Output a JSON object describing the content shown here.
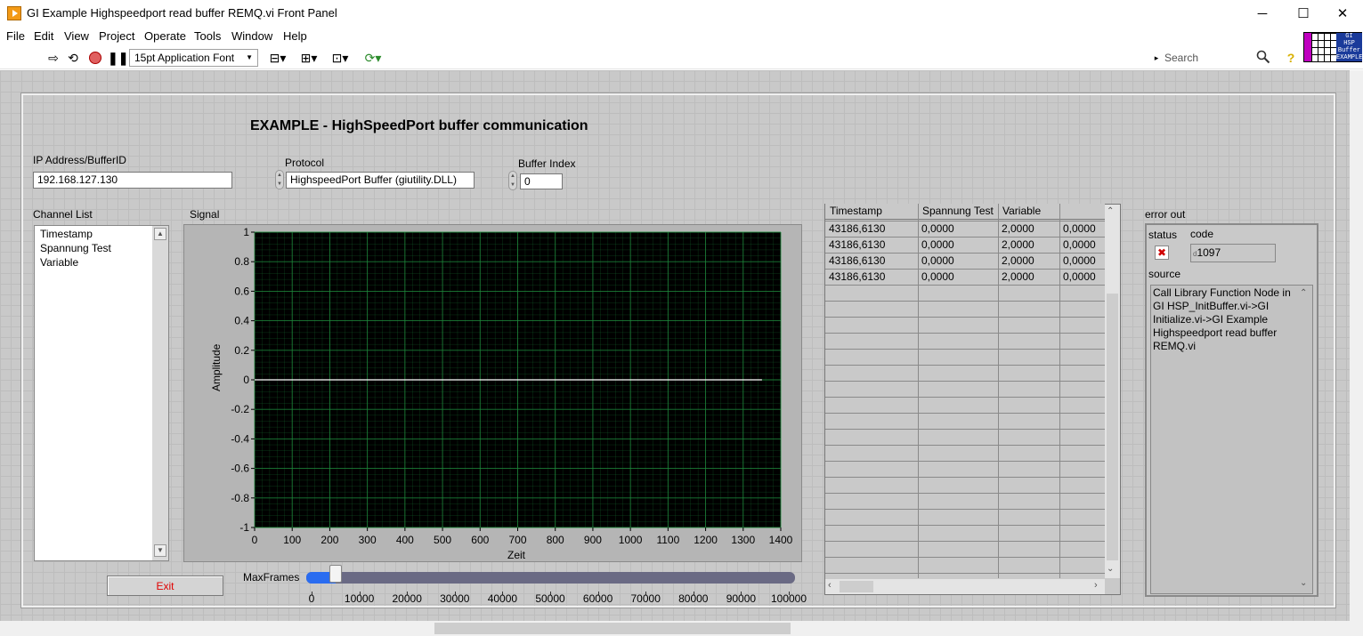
{
  "window": {
    "title": "GI Example Highspeedport read buffer REMQ.vi Front Panel",
    "minimize": "─",
    "maximize": "☐",
    "close": "✕"
  },
  "menu": [
    "File",
    "Edit",
    "View",
    "Project",
    "Operate",
    "Tools",
    "Window",
    "Help"
  ],
  "toolbar": {
    "font": "15pt Application Font",
    "search_placeholder": "Search",
    "icons": [
      "run-arrow-icon",
      "run-continuously-icon",
      "abort-icon",
      "pause-icon",
      "align-icon",
      "distribute-icon",
      "resize-icon",
      "reorder-icon",
      "search-icon",
      "help-icon"
    ]
  },
  "vi_icon": {
    "line1": "GI",
    "line2": "HSP",
    "line3": "Buffer",
    "line4": "EXAMPLE"
  },
  "panel": {
    "heading": "EXAMPLE - HighSpeedPort buffer communication",
    "ip_label": "IP Address/BufferID",
    "ip_value": "192.168.127.130",
    "protocol_label": "Protocol",
    "protocol_value": "HighspeedPort Buffer (giutility.DLL)",
    "buffer_index_label": "Buffer Index",
    "buffer_index_value": "0",
    "channel_list_label": "Channel List",
    "channel_list": [
      "Timestamp",
      "Spannung Test",
      "Variable"
    ],
    "exit_label": "Exit",
    "maxframes_label": "MaxFrames",
    "maxframes_value": 5000,
    "maxframes_ticks": [
      "0",
      "10000",
      "20000",
      "30000",
      "40000",
      "50000",
      "60000",
      "70000",
      "80000",
      "90000",
      "100000"
    ]
  },
  "chart_data": {
    "type": "line",
    "title": "Signal",
    "xlabel": "Zeit",
    "ylabel": "Amplitude",
    "xlim": [
      0,
      1400
    ],
    "ylim": [
      -1,
      1
    ],
    "xticks": [
      "0",
      "100",
      "200",
      "300",
      "400",
      "500",
      "600",
      "700",
      "800",
      "900",
      "1000",
      "1100",
      "1200",
      "1300",
      "1400"
    ],
    "yticks": [
      "1",
      "0.8",
      "0.6",
      "0.4",
      "0.2",
      "0",
      "-0.2",
      "-0.4",
      "-0.6",
      "-0.8",
      "-1"
    ],
    "series": [
      {
        "x": [
          0,
          1350
        ],
        "y": [
          0,
          0
        ],
        "color": "#ffffff"
      }
    ],
    "grid": true,
    "background": "#000000",
    "grid_color": "#1e8a3c"
  },
  "table": {
    "headers": [
      "Timestamp",
      "Spannung Test",
      "Variable",
      ""
    ],
    "rows": [
      [
        "43186,6130",
        "0,0000",
        "2,0000",
        "0,0000"
      ],
      [
        "43186,6130",
        "0,0000",
        "2,0000",
        "0,0000"
      ],
      [
        "43186,6130",
        "0,0000",
        "2,0000",
        "0,0000"
      ],
      [
        "43186,6130",
        "0,0000",
        "2,0000",
        "0,0000"
      ]
    ]
  },
  "error_out": {
    "label": "error out",
    "status_label": "status",
    "status_mark": "✖",
    "code_label": "code",
    "code_prefix": "d",
    "code_value": "1097",
    "source_label": "source",
    "source_text": "Call Library Function Node in GI HSP_InitBuffer.vi->GI Initialize.vi->GI Example Highspeedport read buffer REMQ.vi"
  }
}
